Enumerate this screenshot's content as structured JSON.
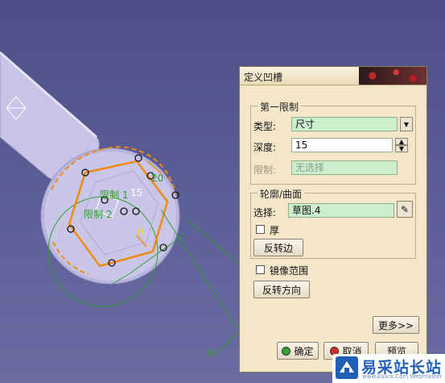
{
  "dialog": {
    "title": "定义凹槽",
    "first_limit": {
      "legend": "第一限制",
      "type_label": "类型:",
      "type_value": "尺寸",
      "depth_label": "深度:",
      "depth_value": "15",
      "limit_label": "限制:",
      "limit_value": "无选择"
    },
    "profile": {
      "legend": "轮廓/曲面",
      "select_label": "选择:",
      "select_value": "草图.4",
      "thick_label": "厚",
      "reverse_side_label": "反转边"
    },
    "mirror_label": "镜像范围",
    "reverse_dir_label": "反转方向",
    "more_label": "更多>>",
    "ok_label": "确定",
    "cancel_label": "取消",
    "preview_label": "预览"
  },
  "viewport": {
    "label_lim1": "限制 1",
    "label_lim2": "限制 2",
    "label_15": "15",
    "label_20": "20",
    "label_h": "H",
    "label_6": "6"
  },
  "watermark": {
    "text": "易采站长站",
    "sub": "www.Easck.Com Webmaster"
  },
  "colors": {
    "accent_green": "#2f9e2f",
    "profile_orange": "#f08a10",
    "background": "#50528a"
  }
}
